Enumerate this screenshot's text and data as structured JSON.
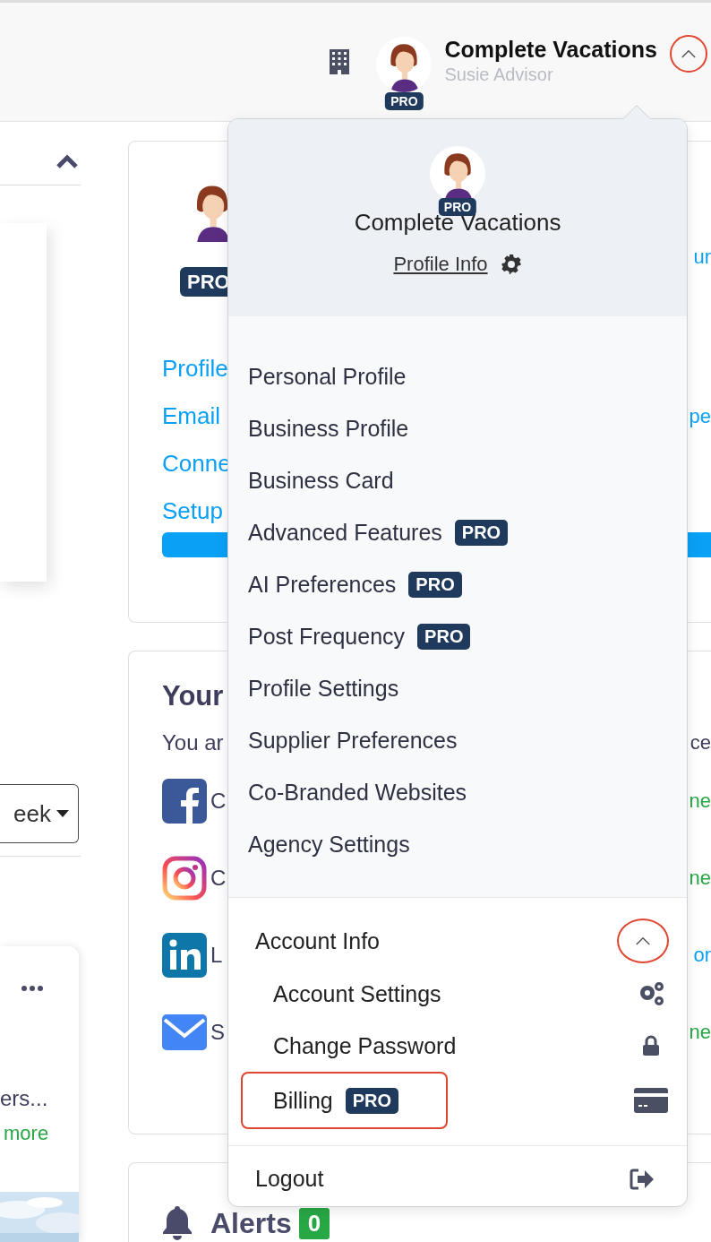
{
  "header": {
    "title": "Complete Vacations",
    "subtitle": "Susie Advisor",
    "badge": "PRO",
    "menu_expanded": true,
    "annotated": true
  },
  "left_panel": {
    "period_select": "eek",
    "card_text": "ers...",
    "card_link": "more"
  },
  "profile_card": {
    "badge": "PRO",
    "links": [
      "Profile",
      "Email",
      "Conne",
      "Setup"
    ],
    "edge_texts": [
      "ur",
      "pe"
    ]
  },
  "social_card": {
    "title": "Your",
    "text": "You ar",
    "text_edge": "ce",
    "rows": [
      {
        "kind": "facebook",
        "label": "C",
        "status": "ne",
        "color": "#28a745"
      },
      {
        "kind": "instagram",
        "label": "C",
        "status": "ne",
        "color": "#28a745"
      },
      {
        "kind": "linkedin",
        "label": "L",
        "status": "or",
        "color": "#0aa0f5"
      },
      {
        "kind": "mail",
        "label": "S",
        "status": "ne",
        "color": "#28a745"
      }
    ]
  },
  "alerts": {
    "title": "Alerts",
    "count": "0"
  },
  "menu": {
    "title": "Complete Vacations",
    "badge": "PRO",
    "profile_link": "Profile Info",
    "items": [
      {
        "label": "Personal Profile"
      },
      {
        "label": "Business Profile"
      },
      {
        "label": "Business Card"
      },
      {
        "label": "Advanced Features",
        "badge": "PRO"
      },
      {
        "label": "AI Preferences",
        "badge": "PRO"
      },
      {
        "label": "Post Frequency",
        "badge": "PRO"
      },
      {
        "label": "Profile Settings"
      },
      {
        "label": "Supplier Preferences"
      },
      {
        "label": "Co-Branded Websites"
      },
      {
        "label": "Agency Settings"
      }
    ],
    "account": {
      "label": "Account Info",
      "expanded": true,
      "annotated": true,
      "items": [
        {
          "kind": "settings",
          "label": "Account Settings",
          "annotated": false
        },
        {
          "kind": "password",
          "label": "Change Password",
          "annotated": false
        },
        {
          "kind": "billing",
          "label": "Billing",
          "badge": "PRO",
          "annotated": true
        }
      ]
    },
    "logout": "Logout"
  }
}
